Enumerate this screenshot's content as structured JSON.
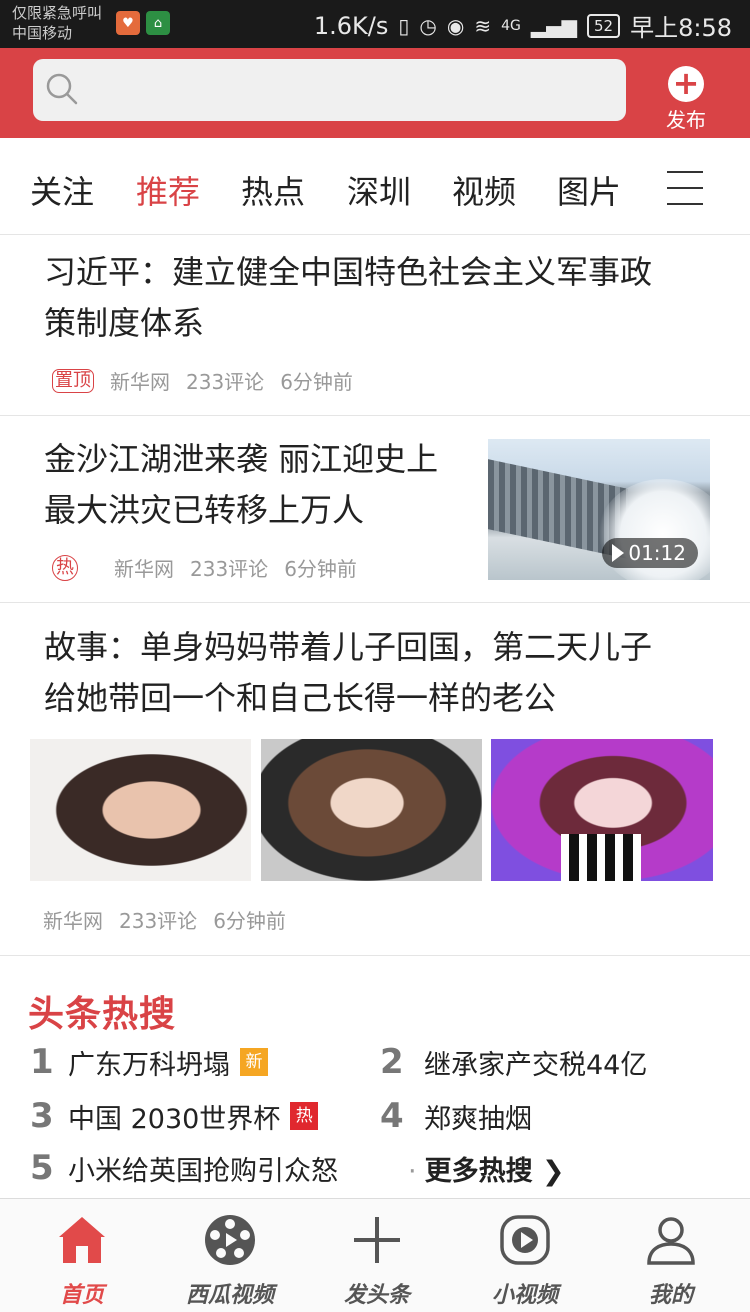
{
  "status_bar": {
    "line1": "仅限紧急呼叫",
    "line2": "中国移动",
    "speed": "1.6K/s",
    "network": "4G",
    "battery": "52",
    "time": "早上8:58"
  },
  "header": {
    "search_placeholder": "",
    "publish_label": "发布"
  },
  "tabs": [
    "关注",
    "推荐",
    "热点",
    "深圳",
    "视频",
    "图片"
  ],
  "articles": [
    {
      "title_line1": "习近平：建立健全中国特色社会主义军事政",
      "title_line2": "策制度体系",
      "tag": "置顶",
      "source": "新华网",
      "comments": "233评论",
      "time": "6分钟前"
    },
    {
      "title_line1": "金沙江湖泄来袭 丽江迎史上",
      "title_line2": "最大洪灾已转移上万人",
      "tag": "热",
      "source": "新华网",
      "comments": "233评论",
      "time": "6分钟前",
      "duration": "01:12"
    },
    {
      "title_line1": "故事：单身妈妈带着儿子回国，第二天儿子",
      "title_line2": "给她带回一个和自己长得一样的老公",
      "source": "新华网",
      "comments": "233评论",
      "time": "6分钟前"
    }
  ],
  "hot_search": {
    "title": "头条热搜",
    "items": [
      {
        "rank": "1",
        "text": "广东万科坍塌",
        "badge": "新"
      },
      {
        "rank": "2",
        "text": "继承家产交税44亿"
      },
      {
        "rank": "3",
        "text": "中国 2030世界杯",
        "badge": "热"
      },
      {
        "rank": "4",
        "text": "郑爽抽烟"
      },
      {
        "rank": "5",
        "text": "小米给英国抢购引众怒"
      }
    ],
    "more": "更多热搜"
  },
  "bottom_nav": [
    {
      "label": "首页",
      "icon": "home-icon"
    },
    {
      "label": "西瓜视频",
      "icon": "film-reel-icon"
    },
    {
      "label": "发头条",
      "icon": "plus-icon"
    },
    {
      "label": "小视频",
      "icon": "play-icon"
    },
    {
      "label": "我的",
      "icon": "user-icon"
    }
  ],
  "colors": {
    "accent": "#d94346",
    "hot_badge": "#e0282e",
    "new_badge": "#f5a623"
  }
}
